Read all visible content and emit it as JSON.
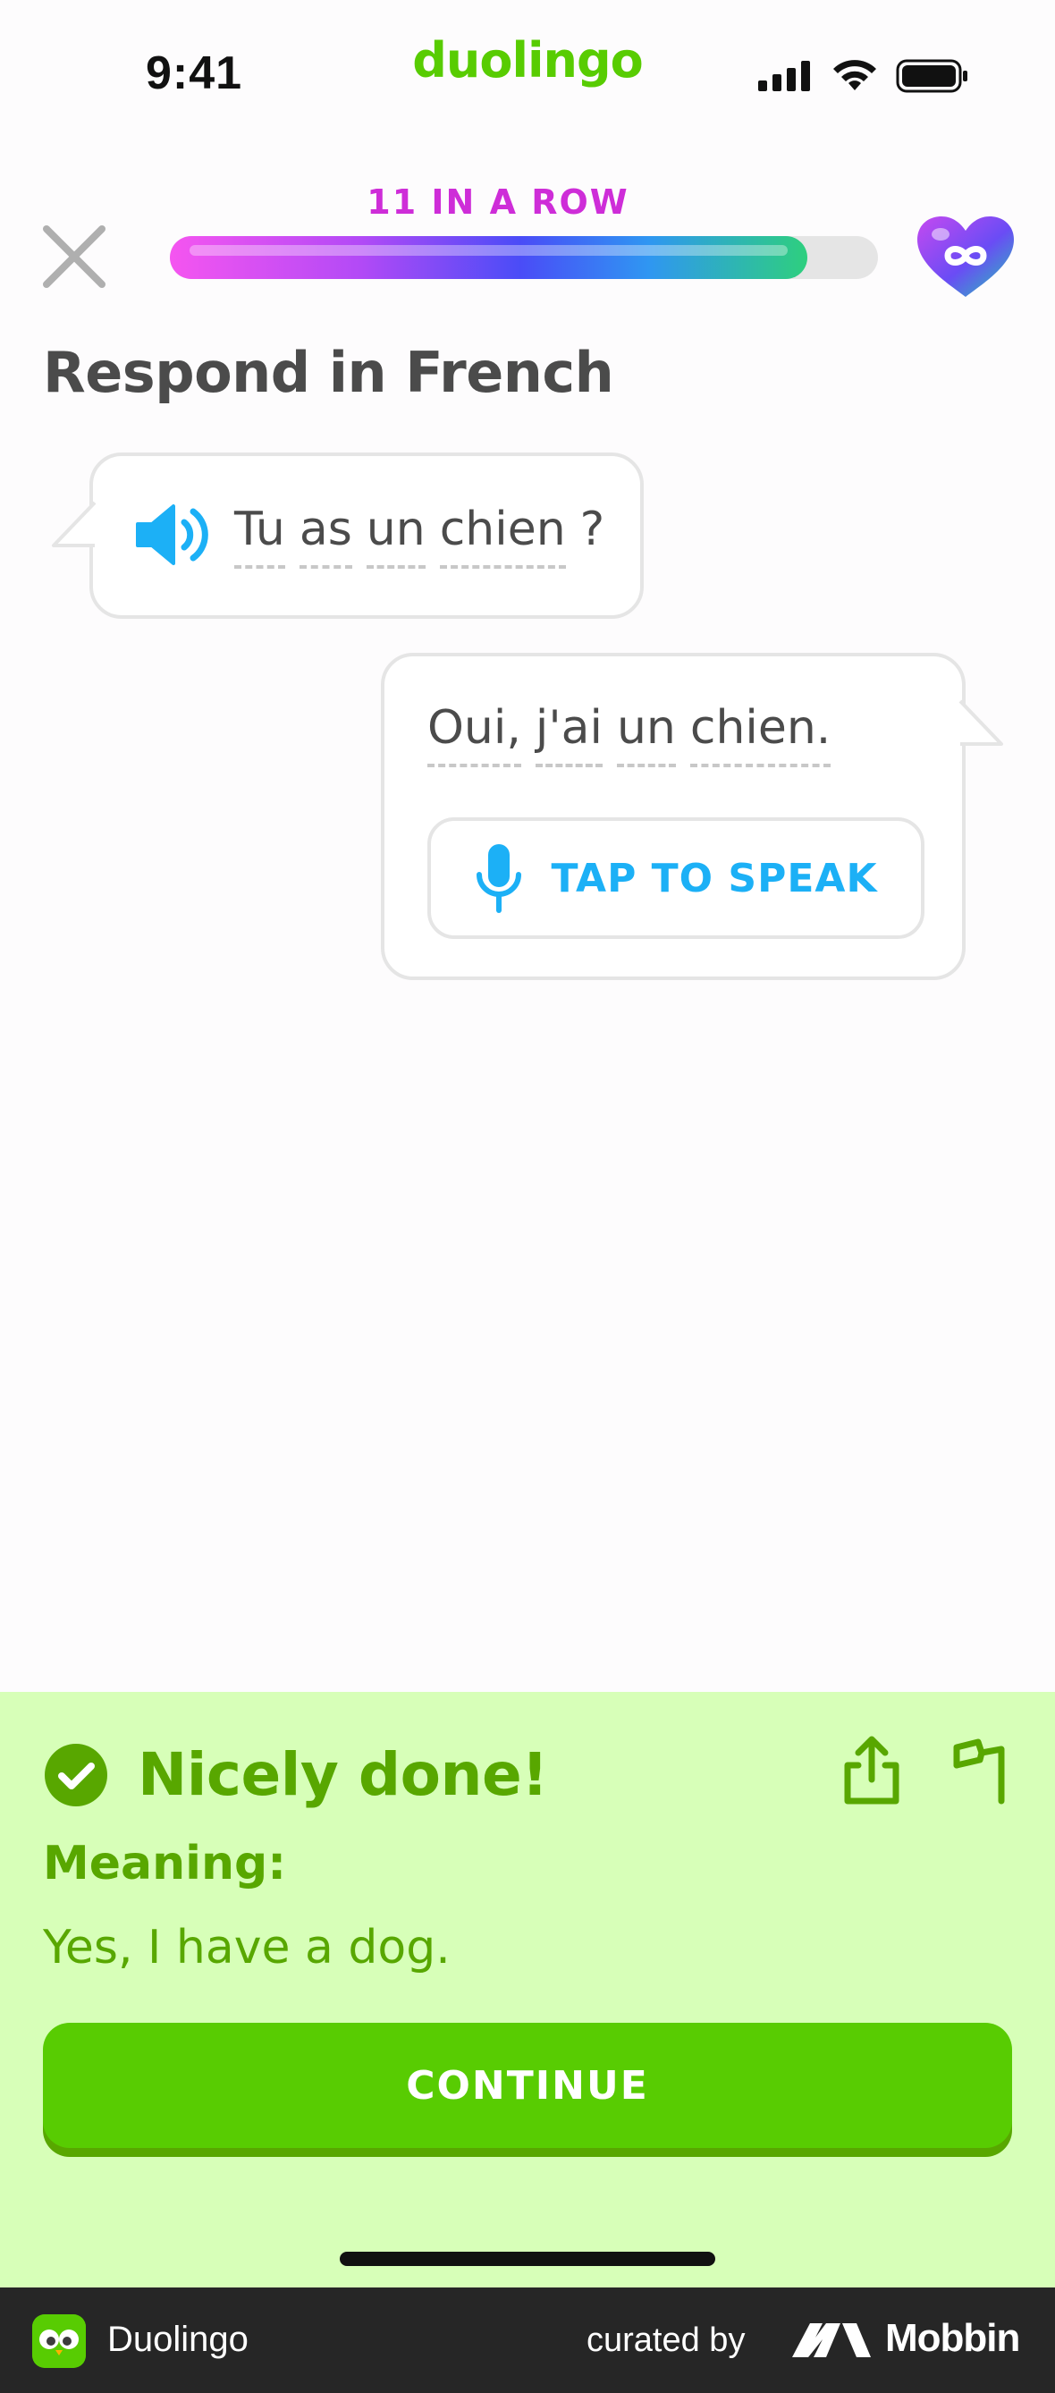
{
  "status_bar": {
    "time": "9:41",
    "brand": "duolingo"
  },
  "header": {
    "streak_label": "11 IN A ROW",
    "progress_fraction": 0.9,
    "hearts": "infinite"
  },
  "prompt": {
    "title": "Respond in French"
  },
  "question": {
    "words": [
      "Tu",
      "as",
      "un",
      "chien",
      "?"
    ]
  },
  "answer": {
    "words": [
      "Oui,",
      "j'ai",
      "un",
      "chien."
    ],
    "tap_to_speak": "TAP TO SPEAK"
  },
  "feedback": {
    "title": "Nicely done!",
    "meaning_label": "Meaning:",
    "meaning_text": "Yes, I have a dog.",
    "continue_label": "CONTINUE"
  },
  "footer": {
    "app_name": "Duolingo",
    "curated_by": "curated by",
    "mobbin": "Mobbin"
  },
  "colors": {
    "brand_green": "#58cc02",
    "feedback_bg": "#d7ffb8",
    "feedback_text": "#58a700",
    "streak_magenta": "#ce2dd8",
    "blue": "#1cb0f6"
  },
  "icons": [
    "close-icon",
    "infinite-heart-icon",
    "speaker-icon",
    "microphone-icon",
    "check-circle-icon",
    "share-icon",
    "flag-icon",
    "owl-icon",
    "mobbin-logo-icon"
  ]
}
